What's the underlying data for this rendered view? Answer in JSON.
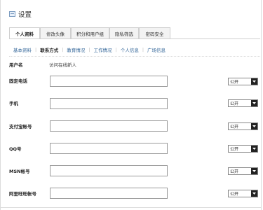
{
  "header": {
    "title": "设置"
  },
  "tabs": [
    {
      "label": "个人资料"
    },
    {
      "label": "修改头像"
    },
    {
      "label": "积分和用户组"
    },
    {
      "label": "隐私筛选"
    },
    {
      "label": "密码安全"
    }
  ],
  "subnav": [
    {
      "label": "基本资料"
    },
    {
      "label": "联系方式"
    },
    {
      "label": "教育情况"
    },
    {
      "label": "工作情况"
    },
    {
      "label": "个人信息"
    },
    {
      "label": "广场信息"
    }
  ],
  "username": {
    "label": "用户名",
    "value": "访问在线新人"
  },
  "fields": [
    {
      "label": "固定电话",
      "value": "",
      "privacy": "公开"
    },
    {
      "label": "手机",
      "value": "",
      "privacy": "公开"
    },
    {
      "label": "支付宝帐号",
      "value": "",
      "privacy": "公开"
    },
    {
      "label": "QQ号",
      "value": "",
      "privacy": "公开"
    },
    {
      "label": "MSN帐号",
      "value": "",
      "privacy": "公开"
    },
    {
      "label": "阿里旺旺帐号",
      "value": "",
      "privacy": "公开"
    }
  ]
}
